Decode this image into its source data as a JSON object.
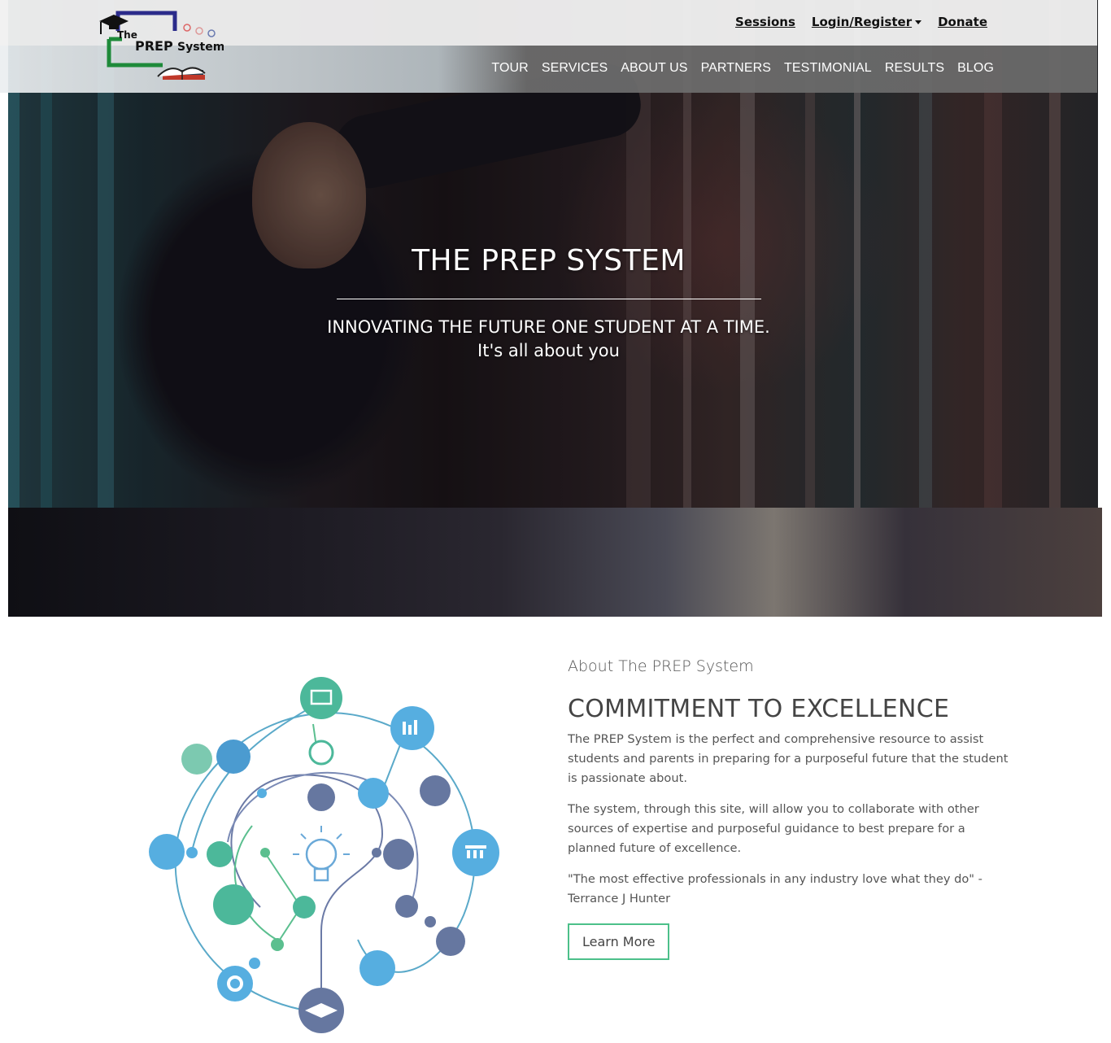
{
  "header": {
    "logo_text_the": "The",
    "logo_text_prep": "PREP",
    "logo_text_system": "System",
    "top_links": {
      "sessions": "Sessions",
      "login": "Login/Register",
      "donate": "Donate"
    },
    "nav": [
      "TOUR",
      "SERVICES",
      "ABOUT US",
      "PARTNERS",
      "TESTIMONIAL",
      "RESULTS",
      "BLOG"
    ]
  },
  "hero": {
    "title": "THE PREP SYSTEM",
    "tagline": "INNOVATING THE FUTURE ONE STUDENT AT A TIME.",
    "subtagline": "It's all about you"
  },
  "about": {
    "kicker": "About The PREP System",
    "heading": "COMMITMENT TO EXCELLENCE",
    "paragraphs": [
      "The PREP System is the perfect and comprehensive resource to assist students and parents in preparing for a purposeful future that the student is passionate about.",
      "The system, through this site, will allow you to collaborate with other sources of expertise and purposeful guidance to best prepare for a planned future of excellence.",
      "\"The most effective professionals in any industry love what they do\" - Terrance J Hunter"
    ],
    "button": "Learn More"
  },
  "colors": {
    "accent_green": "#4cc08a",
    "teal": "#4fbf9f",
    "blue": "#56aee0",
    "slate": "#6677a0",
    "nav_bg": "#6a6a6a"
  }
}
